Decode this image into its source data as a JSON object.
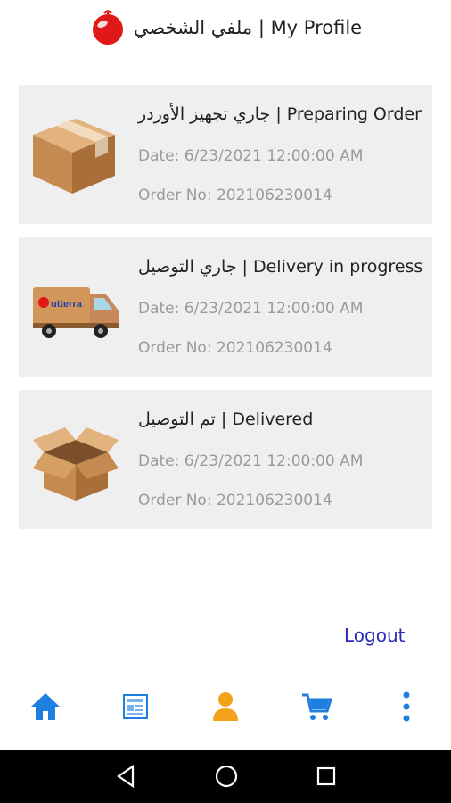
{
  "header": {
    "title": "ملفي الشخصي | My Profile",
    "logo_icon": "ornament-logo-icon"
  },
  "orders": [
    {
      "status": "جاري تجهيز الأوردر | Preparing Order",
      "date": "Date: 6/23/2021 12:00:00 AM",
      "order_no": "Order No: 202106230014",
      "icon": "closed-box-icon"
    },
    {
      "status": "جاري التوصيل | Delivery in progress",
      "date": "Date: 6/23/2021 12:00:00 AM",
      "order_no": "Order No: 202106230014",
      "icon": "delivery-van-icon"
    },
    {
      "status": "تم التوصيل | Delivered",
      "date": "Date: 6/23/2021 12:00:00 AM",
      "order_no": "Order No: 202106230014",
      "icon": "open-box-icon"
    }
  ],
  "truck_label": "utterra",
  "logout_label": "Logout",
  "tabbar": [
    {
      "name": "home-icon",
      "color": "#1e7fe0"
    },
    {
      "name": "catalog-icon",
      "color": "#1e7fe0"
    },
    {
      "name": "profile-icon",
      "color": "#f5a21b"
    },
    {
      "name": "cart-icon",
      "color": "#1e7fe0"
    },
    {
      "name": "more-icon",
      "color": "#1e7fe0"
    }
  ],
  "system_nav": [
    "back-icon",
    "home-circle-icon",
    "recents-icon"
  ]
}
